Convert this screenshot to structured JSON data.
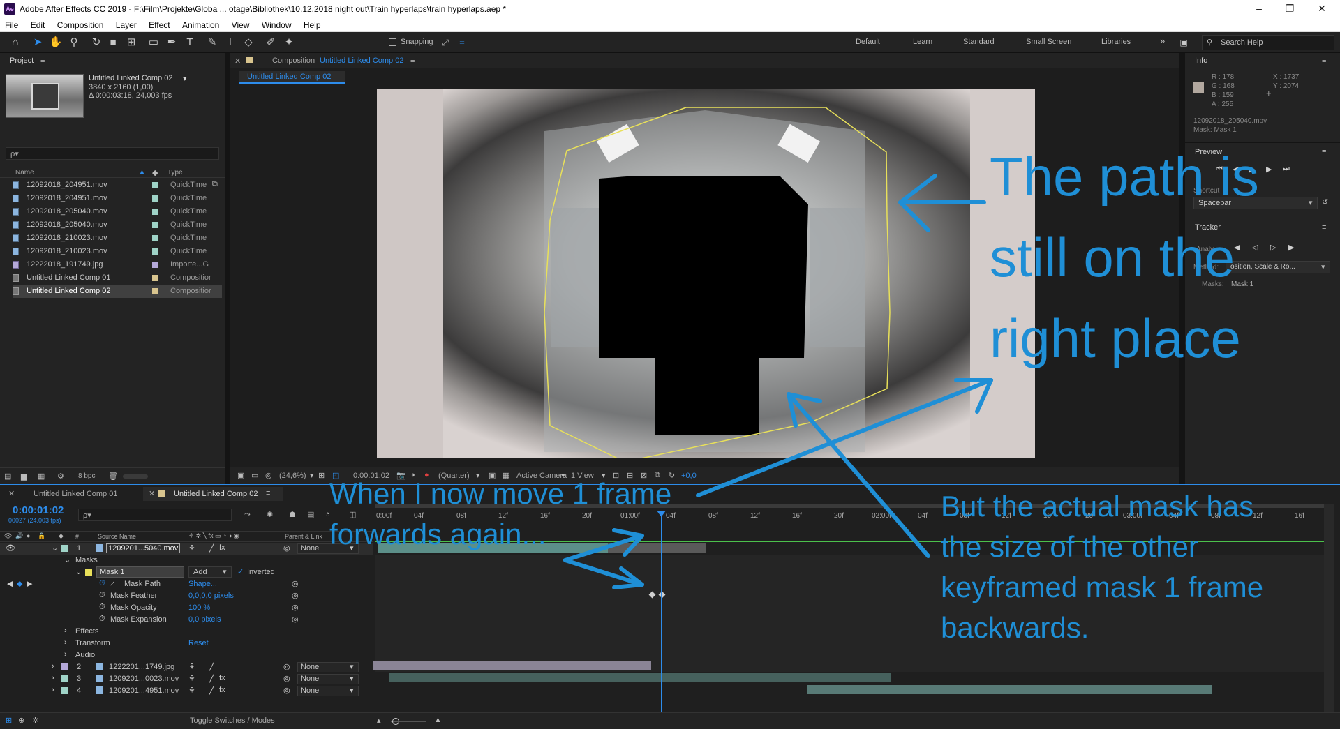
{
  "window": {
    "title": "Adobe After Effects CC 2019 - F:\\Film\\Projekte\\Globa ... otage\\Bibliothek\\10.12.2018 night out\\Train hyperlaps\\train hyperlaps.aep *",
    "app_logo": "Ae"
  },
  "menu": [
    "File",
    "Edit",
    "Composition",
    "Layer",
    "Effect",
    "Animation",
    "View",
    "Window",
    "Help"
  ],
  "toolbar": {
    "snapping_label": "Snapping",
    "workspaces": [
      "Default",
      "Learn",
      "Standard",
      "Small Screen",
      "Libraries"
    ],
    "search_placeholder": "Search Help"
  },
  "project": {
    "panel_label": "Project",
    "selected_name": "Untitled Linked Comp 02",
    "selected_info_1": "3840 x 2160 (1,00)",
    "selected_info_2": "Δ 0:00:03:18, 24,003 fps",
    "search_placeholder": "ρ▾",
    "col_name": "Name",
    "col_type": "Type",
    "items": [
      {
        "name": "12092018_204951.mov",
        "type": "QuickTime",
        "color": "#9fd3c7"
      },
      {
        "name": "12092018_204951.mov",
        "type": "QuickTime",
        "color": "#9fd3c7"
      },
      {
        "name": "12092018_205040.mov",
        "type": "QuickTime",
        "color": "#9fd3c7"
      },
      {
        "name": "12092018_205040.mov",
        "type": "QuickTime",
        "color": "#9fd3c7"
      },
      {
        "name": "12092018_210023.mov",
        "type": "QuickTime",
        "color": "#9fd3c7"
      },
      {
        "name": "12092018_210023.mov",
        "type": "QuickTime",
        "color": "#9fd3c7"
      },
      {
        "name": "12222018_191749.jpg",
        "type": "Importe...G",
        "color": "#b4a8d8"
      },
      {
        "name": "Untitled Linked Comp 01",
        "type": "Compositior",
        "color": "#d8c48e"
      },
      {
        "name": "Untitled Linked Comp 02",
        "type": "Compositior",
        "color": "#d8c48e"
      }
    ],
    "bpc": "8 bpc"
  },
  "composition": {
    "panel_prefix": "Composition",
    "panel_name": "Untitled Linked Comp 02",
    "tab_label": "Untitled Linked Comp 02",
    "zoom": "(24,6%)",
    "timecode": "0:00:01:02",
    "resolution": "(Quarter)",
    "camera": "Active Camera",
    "views": "1 View",
    "exposure": "+0,0"
  },
  "info": {
    "panel_label": "Info",
    "r": "R : 178",
    "g": "G : 168",
    "b": "B : 159",
    "a": "A : 255",
    "x": "X : 1737",
    "y": "Y : 2074",
    "source": "12092018_205040.mov",
    "mask": "Mask: Mask 1",
    "swatch_color": "#b2a89f"
  },
  "preview": {
    "panel_label": "Preview",
    "shortcut_label": "Shortcut",
    "shortcut_value": "Spacebar"
  },
  "tracker": {
    "panel_label": "Tracker",
    "method_label": "Method:",
    "method_value": "osition, Scale & Ro...",
    "masks_label": "Masks:",
    "masks_value": "Mask 1",
    "analyze_label": "Analy"
  },
  "timeline": {
    "tabs": [
      "Untitled Linked Comp 01",
      "Untitled Linked Comp 02"
    ],
    "timecode": "0:00:01:02",
    "frame_info": "00027 (24.003 fps)",
    "col_source": "Source Name",
    "col_parent": "Parent & Link",
    "ruler": [
      "0:00f",
      "04f",
      "08f",
      "12f",
      "16f",
      "20f",
      "01:00f",
      "04f",
      "08f",
      "12f",
      "16f",
      "20f",
      "02:00f",
      "04f",
      "08f",
      "12f",
      "16f",
      "20f",
      "03:00f",
      "04f",
      "08f",
      "12f",
      "16f"
    ],
    "layers": [
      {
        "num": "1",
        "name": "1209201...5040.mov",
        "parent": "None",
        "color": "#9fd3c7"
      },
      {
        "num": "2",
        "name": "1222201...1749.jpg",
        "parent": "None",
        "color": "#b4a8d8"
      },
      {
        "num": "3",
        "name": "1209201...0023.mov",
        "parent": "None",
        "color": "#9fd3c7"
      },
      {
        "num": "4",
        "name": "1209201...4951.mov",
        "parent": "None",
        "color": "#9fd3c7"
      }
    ],
    "masks_group": "Masks",
    "mask_name": "Mask 1",
    "mask_mode": "Add",
    "inverted_label": "Inverted",
    "props": [
      {
        "label": "Mask Path",
        "value": "Shape..."
      },
      {
        "label": "Mask Feather",
        "value": "0,0,0,0 pixels"
      },
      {
        "label": "Mask Opacity",
        "value": "100 %"
      },
      {
        "label": "Mask Expansion",
        "value": "0,0 pixels"
      }
    ],
    "effects_label": "Effects",
    "transform_label": "Transform",
    "transform_reset": "Reset",
    "audio_label": "Audio",
    "toggle_label": "Toggle Switches / Modes"
  },
  "annotations": {
    "path_text_1": "The path is",
    "path_text_2": "still on the",
    "path_text_3": "right place",
    "move_text_1": "When I now move 1 frame",
    "move_text_2": "forwards again...",
    "mask_text_1": "But the actual mask has",
    "mask_text_2": "the size of the other",
    "mask_text_3": "keyframed mask 1 frame",
    "mask_text_4": "backwards."
  }
}
